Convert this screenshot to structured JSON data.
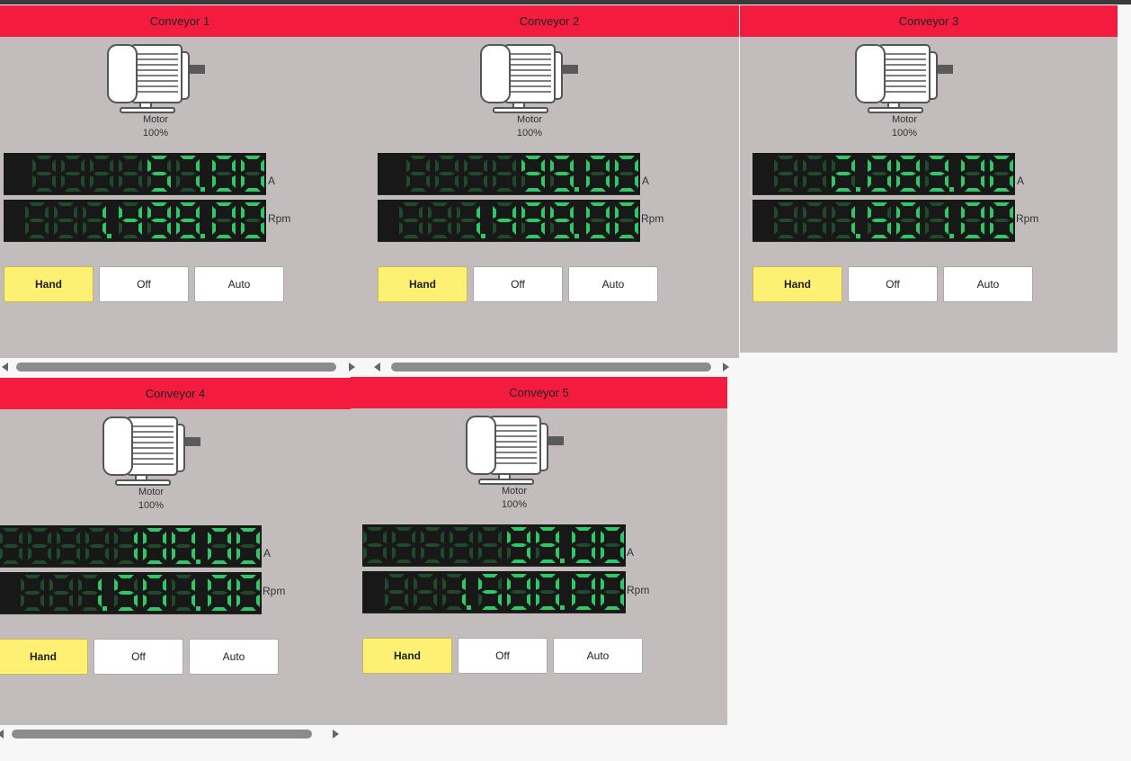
{
  "conveyors": [
    {
      "title": "Conveyor 1",
      "motor_label": "Motor",
      "motor_percent": "100%",
      "current": "57.00",
      "current_unit": "A",
      "speed": "1,498.00",
      "speed_unit": "Rpm",
      "buttons": [
        "Hand",
        "Off",
        "Auto"
      ],
      "active_mode": "Hand"
    },
    {
      "title": "Conveyor 2",
      "motor_label": "Motor",
      "motor_percent": "100%",
      "current": "99.00",
      "current_unit": "A",
      "speed": "1,499.00",
      "speed_unit": "Rpm",
      "buttons": [
        "Hand",
        "Off",
        "Auto"
      ],
      "active_mode": "Hand"
    },
    {
      "title": "Conveyor 3",
      "motor_label": "Motor",
      "motor_percent": "100%",
      "current": "2,083.00",
      "current_unit": "A",
      "speed": "1,501.00",
      "speed_unit": "Rpm",
      "buttons": [
        "Hand",
        "Off",
        "Auto"
      ],
      "active_mode": "Hand"
    },
    {
      "title": "Conveyor 4",
      "motor_label": "Motor",
      "motor_percent": "100%",
      "current": "100.00",
      "current_unit": "A",
      "speed": "1,501.00",
      "speed_unit": "Rpm",
      "buttons": [
        "Hand",
        "Off",
        "Auto"
      ],
      "active_mode": "Hand"
    },
    {
      "title": "Conveyor 5",
      "motor_label": "Motor",
      "motor_percent": "100%",
      "current": "99.00",
      "current_unit": "A",
      "speed": "1,500.00",
      "speed_unit": "Rpm",
      "buttons": [
        "Hand",
        "Off",
        "Auto"
      ],
      "active_mode": "Hand"
    }
  ],
  "colors": {
    "header": "#f31c3e",
    "panel_bg": "#c2bcbc",
    "display_bg": "#181818",
    "segment_on": "#2ec866",
    "segment_off": "#1f4a2c",
    "active_button": "#fef073"
  }
}
